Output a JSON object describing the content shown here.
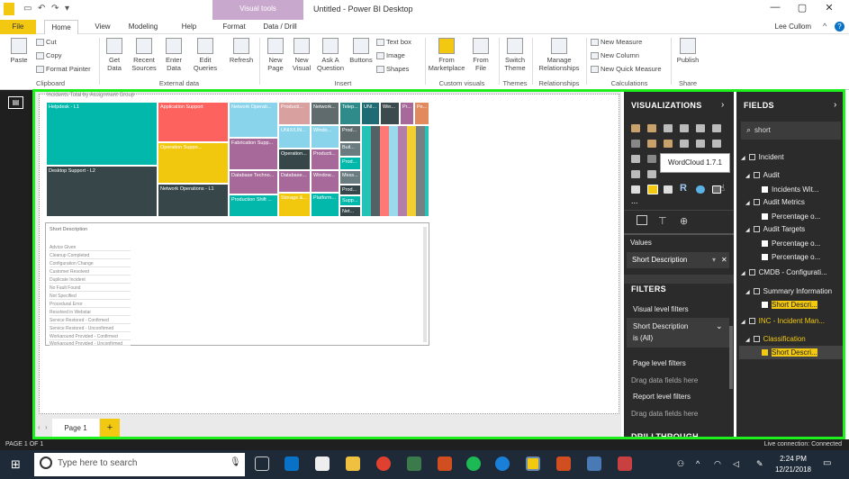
{
  "titlebar": {
    "title": "Untitled - Power BI Desktop",
    "context_tab": "Visual tools",
    "min": "—",
    "max": "▢",
    "close": "✕"
  },
  "tabs": [
    "File",
    "Home",
    "View",
    "Modeling",
    "Help",
    "Format",
    "Data / Drill"
  ],
  "user": "Lee Cullom",
  "ribbon": {
    "clipboard": {
      "paste": "Paste",
      "cut": "Cut",
      "copy": "Copy",
      "format_painter": "Format Painter",
      "group": "Clipboard"
    },
    "external": {
      "get_data": "Get Data",
      "recent": "Recent Sources",
      "enter": "Enter Data",
      "edit": "Edit Queries",
      "refresh": "Refresh",
      "group": "External data"
    },
    "insert": {
      "new_page": "New Page",
      "new_visual": "New Visual",
      "ask": "Ask A Question",
      "buttons": "Buttons",
      "text_box": "Text box",
      "image": "Image",
      "shapes": "Shapes",
      "group": "Insert"
    },
    "custom": {
      "marketplace": "From Marketplace",
      "file": "From File",
      "group": "Custom visuals"
    },
    "themes": {
      "switch": "Switch Theme",
      "group": "Themes"
    },
    "relationships": {
      "manage": "Manage Relationships",
      "group": "Relationships"
    },
    "calculations": {
      "measure": "New Measure",
      "column": "New Column",
      "quick": "New Quick Measure",
      "group": "Calculations"
    },
    "share": {
      "publish": "Publish",
      "group": "Share"
    }
  },
  "treemap": {
    "title": "Incidents Total by Assignment Group",
    "cells": [
      "Helpdesk - L1",
      "Application Support",
      "Network Operati...",
      "Producti...",
      "Network...",
      "Telep...",
      "UNI...",
      "Win...",
      "Pr...",
      "Pe...",
      "Desktop Support - L2",
      "Operation Suppo...",
      "Fabrication Supp...",
      "UNIX/LIN...",
      "Windo...",
      "Prod...",
      "Buil...",
      "Operation...",
      "Producti...",
      "Prod...",
      "Database Techno...",
      "Database...",
      "Window...",
      "Mess...",
      "Network Operations - L1",
      "Prod...",
      "Production Shift ...",
      "Storage &...",
      "Platform...",
      "Supp...",
      "Net..."
    ],
    "colors": {
      "teal": "#01b8aa",
      "dark": "#374649",
      "red": "#fd625e",
      "yellow": "#f2c80f",
      "gray": "#5f6b6d",
      "blue": "#8ad4eb",
      "orange": "#fe9666",
      "purple": "#a66999"
    }
  },
  "slicer": {
    "title": "Short Description",
    "items": [
      "Advice Given",
      "Cleanup Completed",
      "Configuration Change",
      "Customer Resolved",
      "Duplicate Incident",
      "No Fault Found",
      "Not Specified",
      "Procedural Error",
      "Resolved in Webstar",
      "Service Restored - Confirmed",
      "Service Restored - Unconfirmed",
      "Workaround Provided - Confirmed",
      "Workaround Provided - Unconfirmed"
    ]
  },
  "page_tab": "Page 1",
  "add_page": "+",
  "visualizations": {
    "header": "VISUALIZATIONS",
    "tooltip": "WordCloud 1.7.1",
    "values_label": "Values",
    "value_field": "Short Description",
    "filters_header": "FILTERS",
    "visual_filters": "Visual level filters",
    "filter_field": "Short Description",
    "filter_value": "is (All)",
    "page_filters": "Page level filters",
    "drag_here": "Drag data fields here",
    "report_filters": "Report level filters",
    "drag_here2": "Drag data fields here",
    "drillthrough": "DRILLTHROUGH",
    "dots": "..."
  },
  "fields": {
    "header": "FIELDS",
    "search": "short",
    "rows": [
      {
        "label": "Incident",
        "indent": 0,
        "type": "table"
      },
      {
        "label": "Audit",
        "indent": 1,
        "type": "table"
      },
      {
        "label": "Incidents Wit...",
        "indent": 2,
        "type": "field"
      },
      {
        "label": "Audit Metrics",
        "indent": 1,
        "type": "table"
      },
      {
        "label": "Percentage o...",
        "indent": 2,
        "type": "field"
      },
      {
        "label": "Audit Targets",
        "indent": 1,
        "type": "table"
      },
      {
        "label": "Percentage o...",
        "indent": 2,
        "type": "field"
      },
      {
        "label": "Percentage o...",
        "indent": 2,
        "type": "field"
      },
      {
        "label": "CMDB - Configurati...",
        "indent": 0,
        "type": "table"
      },
      {
        "label": "Summary Information",
        "indent": 1,
        "type": "table"
      },
      {
        "label": "Short Descri...",
        "indent": 2,
        "type": "field"
      },
      {
        "label": "INC - Incident Man...",
        "indent": 0,
        "type": "table"
      },
      {
        "label": "Classification",
        "indent": 1,
        "type": "table"
      },
      {
        "label": "Short Descri...",
        "indent": 2,
        "type": "field"
      }
    ]
  },
  "status": {
    "page": "PAGE 1 OF 1",
    "connection": "Live connection: Connected"
  },
  "taskbar": {
    "search": "Type here to search",
    "time": "2:24 PM",
    "date": "12/21/2018"
  }
}
